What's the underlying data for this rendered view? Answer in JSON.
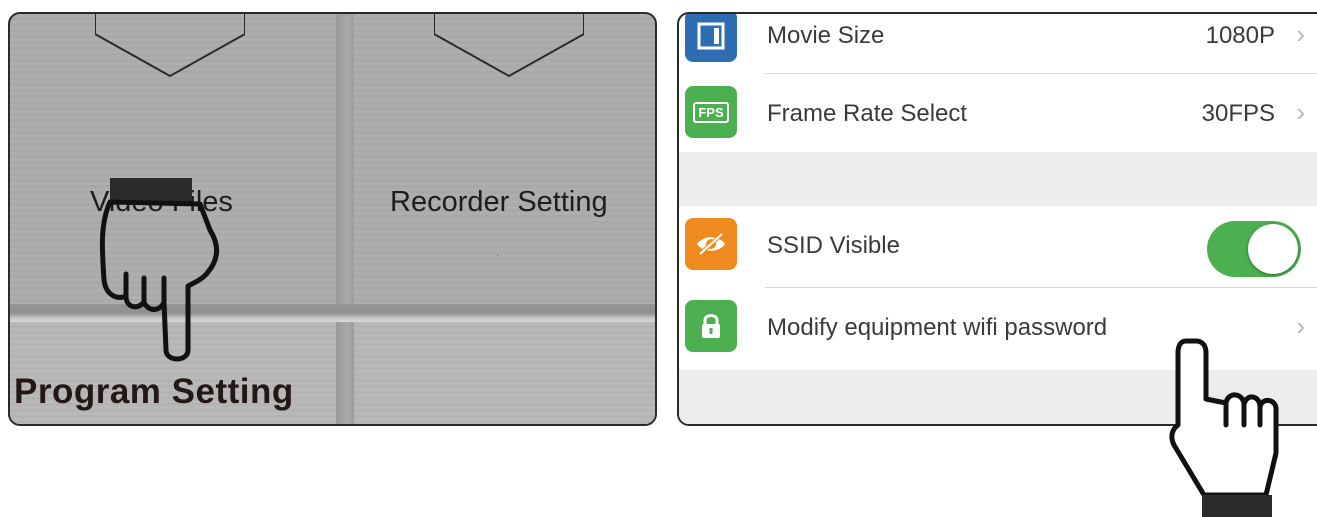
{
  "left": {
    "tile_video_label": "Video Files",
    "tile_recorder_label": "Recorder Setting",
    "caption": "Program Setting"
  },
  "settings": {
    "rows": [
      {
        "label": "Movie Size",
        "value": "1080P",
        "icon": "movie-size-icon",
        "icon_color": "#2f6db3"
      },
      {
        "label": "Frame Rate Select",
        "value": "30FPS",
        "icon": "fps-icon",
        "icon_text": "FPS",
        "icon_color": "#4caf50"
      },
      {
        "label": "SSID Visible",
        "toggle": "on",
        "icon": "eye-slash-icon",
        "icon_color": "#ef8a1f"
      },
      {
        "label": "Modify equipment wifi password",
        "icon": "lock-icon",
        "icon_color": "#4caf50"
      }
    ]
  },
  "colors": {
    "toggle_on": "#4caf50",
    "caption_text": "#231815"
  }
}
